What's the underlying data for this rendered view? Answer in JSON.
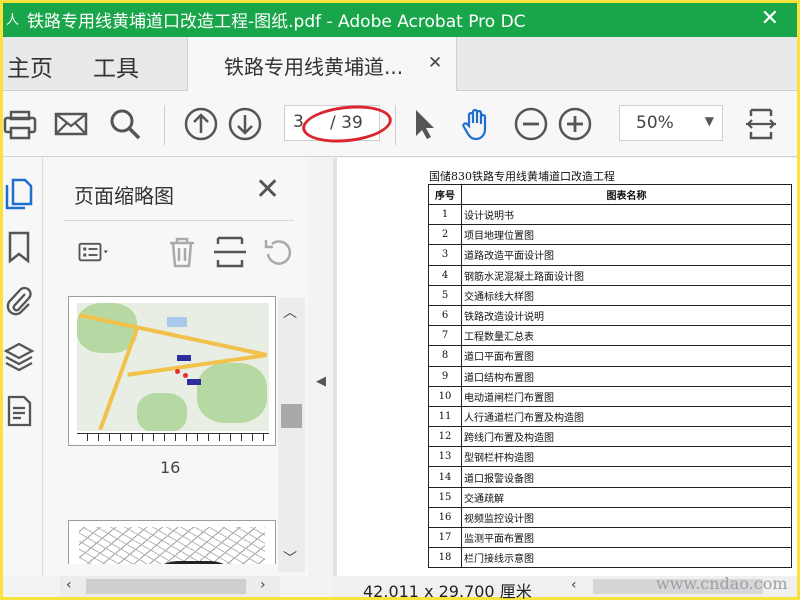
{
  "window": {
    "title": "铁路专用线黄埔道口改造工程-图纸.pdf - Adobe Acrobat Pro DC",
    "app_icon": "acrobat-icon"
  },
  "nav": {
    "home": "主页",
    "tools": "工具"
  },
  "tab": {
    "label": "铁路专用线黄埔道..."
  },
  "toolbar": {
    "current_page": "3",
    "total_pages": "/ 39",
    "zoom": "50%",
    "annotation_color": "#d9262e"
  },
  "sidebar": {
    "title": "页面缩略图",
    "thumbnail_label": "16"
  },
  "document": {
    "header": "国储830铁路专用线黄埔道口改造工程",
    "columns": [
      "序号",
      "图表名称"
    ],
    "rows": [
      [
        "1",
        "设计说明书"
      ],
      [
        "2",
        "项目地理位置图"
      ],
      [
        "3",
        "道路改造平面设计图"
      ],
      [
        "4",
        "钢筋水泥混凝土路面设计图"
      ],
      [
        "5",
        "交通标线大样图"
      ],
      [
        "6",
        "铁路改造设计说明"
      ],
      [
        "7",
        "工程数量汇总表"
      ],
      [
        "8",
        "道口平面布置图"
      ],
      [
        "9",
        "道口结构布置图"
      ],
      [
        "10",
        "电动道闸栏门布置图"
      ],
      [
        "11",
        "人行通道栏门布置及构造图"
      ],
      [
        "12",
        "跨线门布置及构造图"
      ],
      [
        "13",
        "型钢栏杆构造图"
      ],
      [
        "14",
        "道口报警设备图"
      ],
      [
        "15",
        "交通疏解"
      ],
      [
        "16",
        "视频监控设计图"
      ],
      [
        "17",
        "监测平面布置图"
      ],
      [
        "18",
        "栏门接线示意图"
      ]
    ]
  },
  "status": {
    "page_size": "42.011 x 29.700 厘米"
  },
  "watermark": "www.cndao.com",
  "colors": {
    "titlebar": "#19a64a",
    "frame": "#f7e33c",
    "icon_blue": "#1f6fd1"
  }
}
